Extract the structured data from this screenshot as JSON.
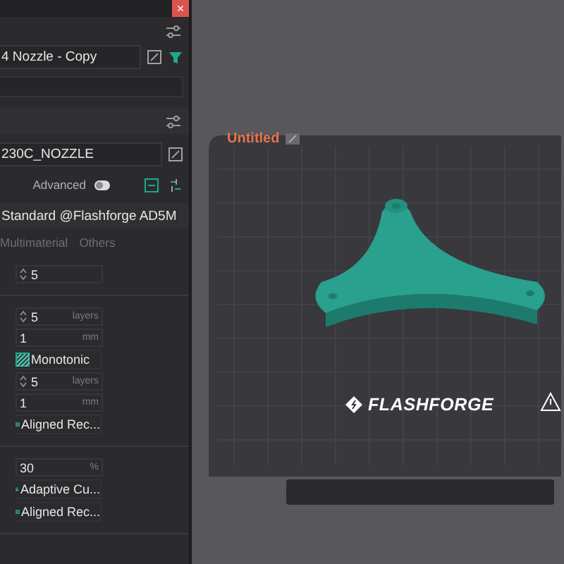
{
  "window": {
    "close_glyph": "×"
  },
  "filament": {
    "preset": "4 Nozzle - Copy",
    "color": "#1fa88e"
  },
  "printer": {
    "nozzle": "230C_NOZZLE"
  },
  "advanced": {
    "label": "Advanced",
    "on": false
  },
  "process": {
    "name": "Standard @Flashforge AD5M"
  },
  "tabs": [
    {
      "label": "Multimaterial",
      "selected": false
    },
    {
      "label": "Others",
      "selected": false
    }
  ],
  "groups": [
    [
      {
        "kind": "spin",
        "value": "5"
      }
    ],
    [
      {
        "kind": "spin",
        "value": "5",
        "unit": "layers"
      },
      {
        "kind": "number",
        "value": "1",
        "unit": "mm"
      },
      {
        "kind": "lines",
        "value": "Monotonic"
      },
      {
        "kind": "spin",
        "value": "5",
        "unit": "layers"
      },
      {
        "kind": "number",
        "value": "1",
        "unit": "mm"
      },
      {
        "kind": "lines",
        "value": "Aligned Rec..."
      }
    ],
    [
      {
        "kind": "number",
        "value": "30",
        "unit": "%"
      },
      {
        "kind": "cubic",
        "value": "Adaptive Cu..."
      },
      {
        "kind": "lines",
        "value": "Aligned Rec..."
      }
    ]
  ],
  "viewport": {
    "plate_title": "Untitled",
    "brand": "FLASHFORGE"
  }
}
